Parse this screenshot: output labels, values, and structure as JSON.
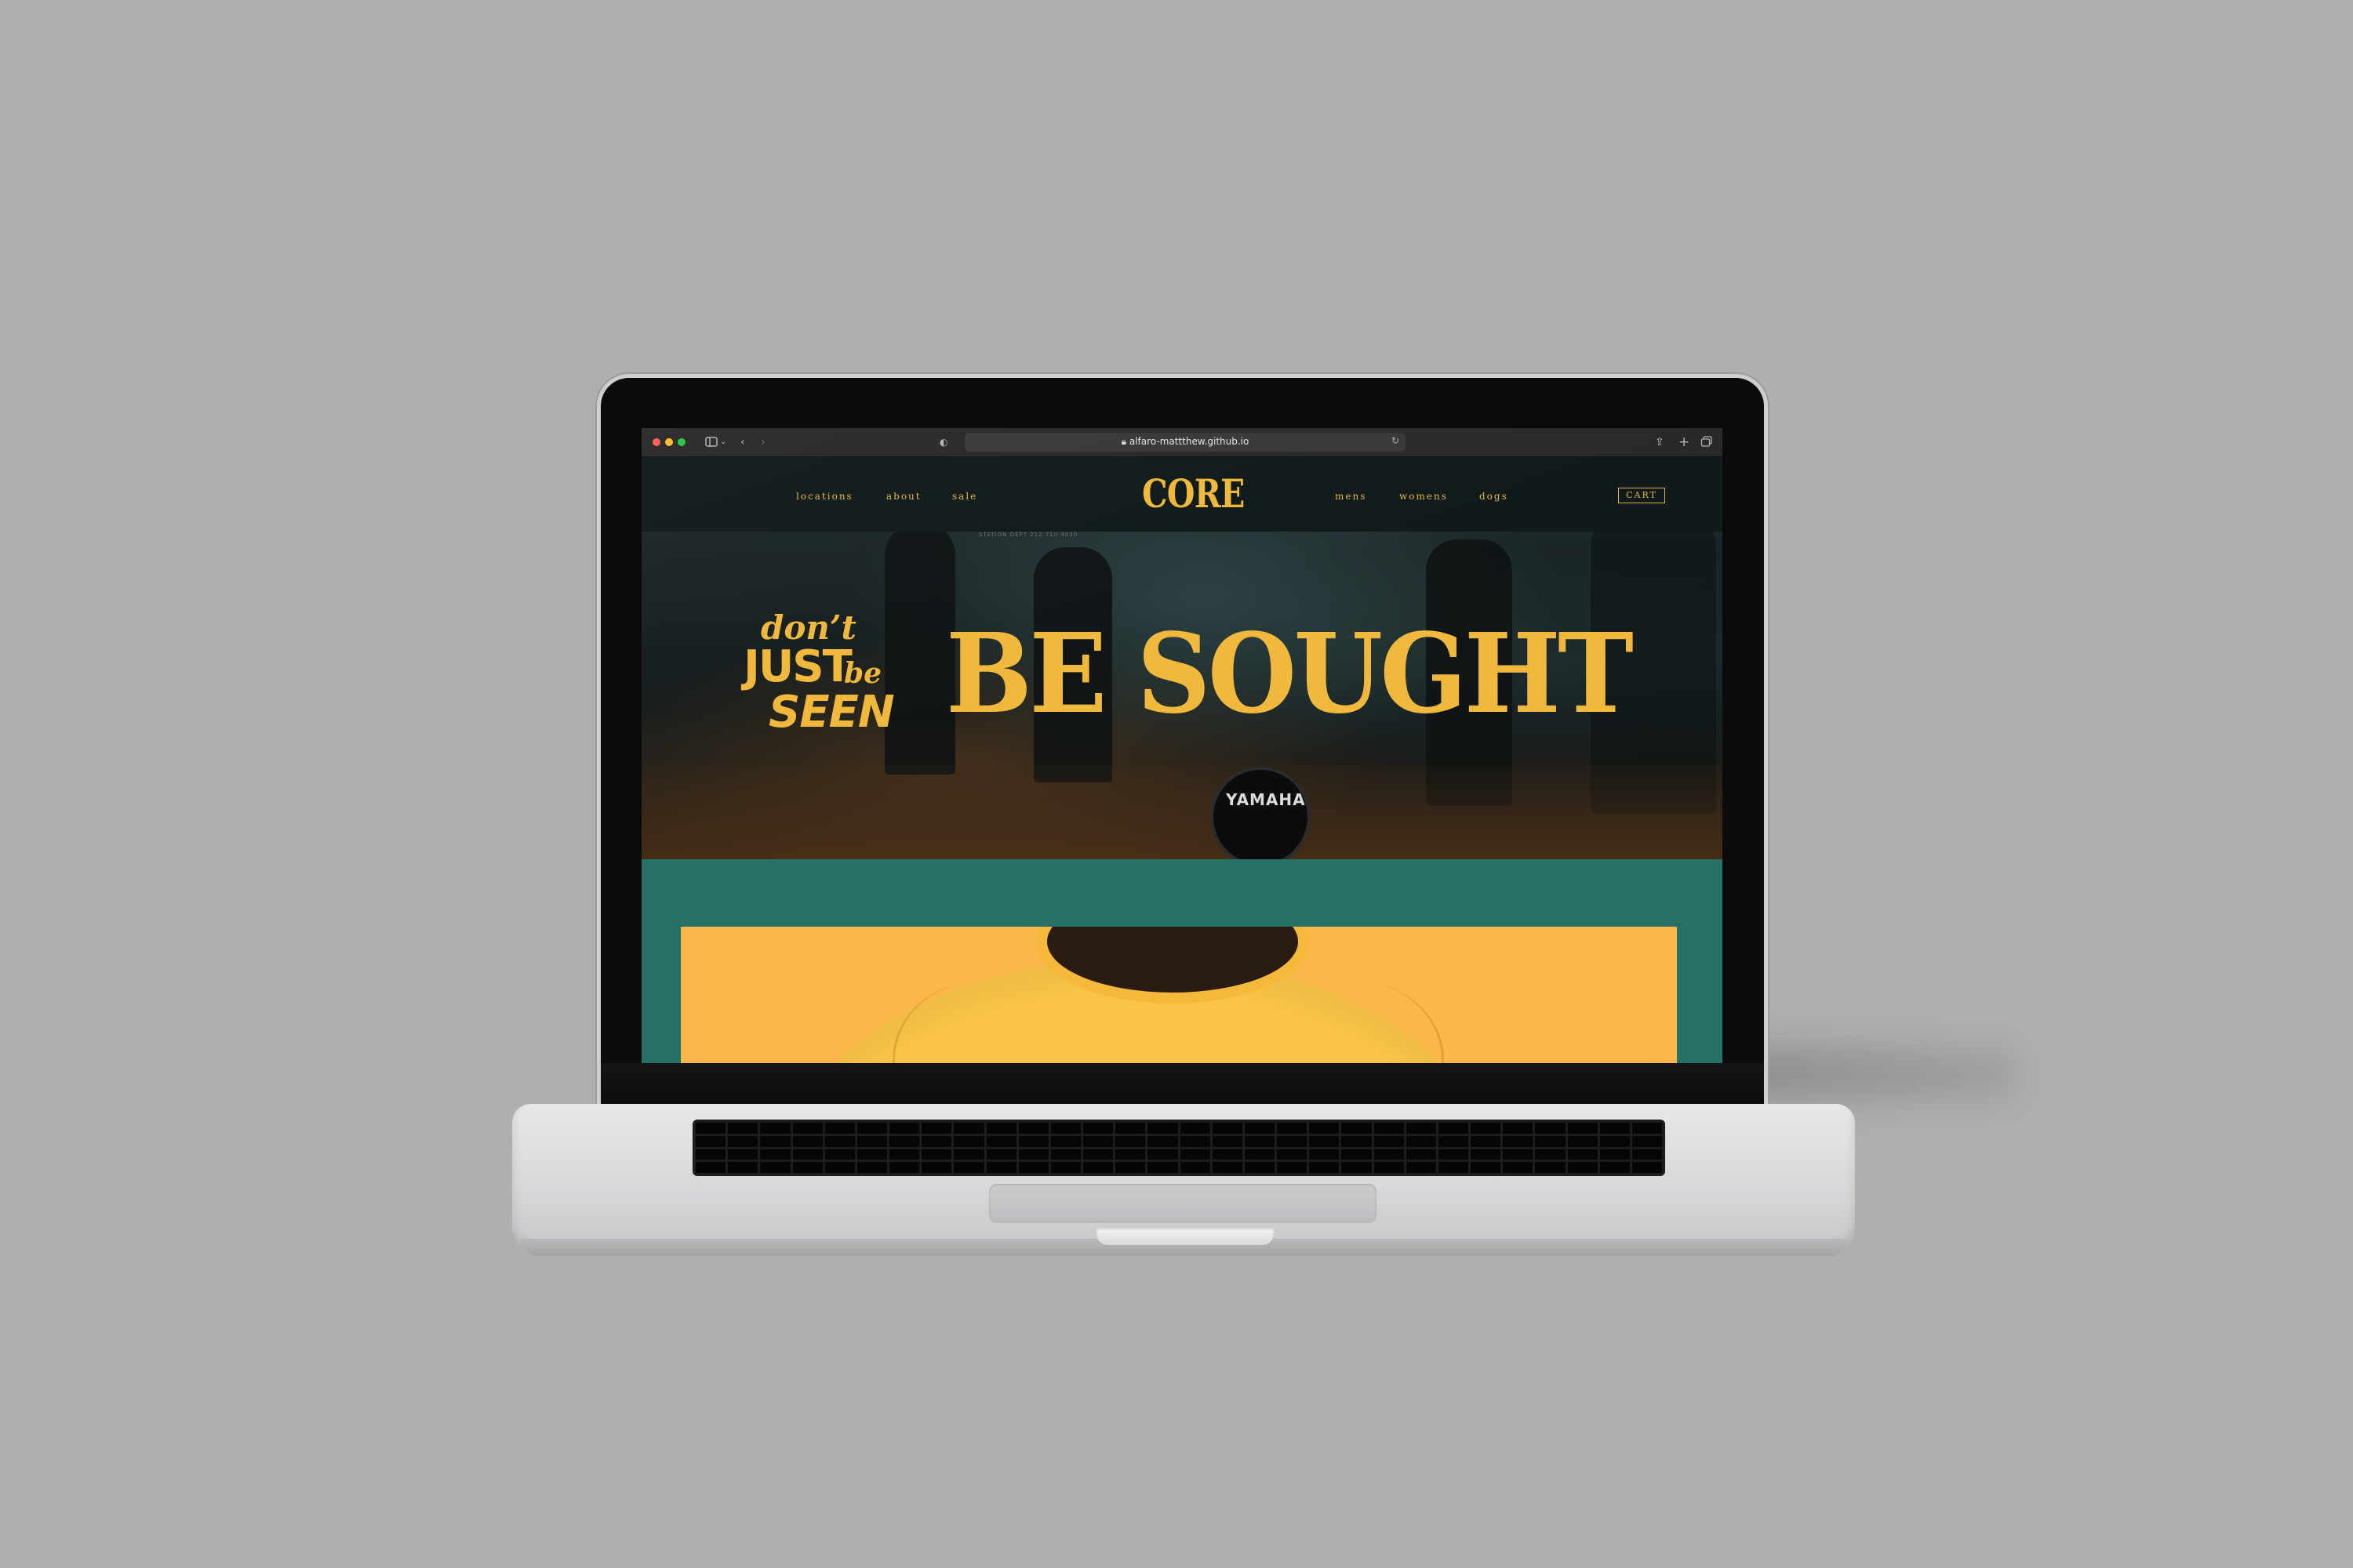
{
  "browser": {
    "url": "alfaro-mattthew.github.io",
    "icons": [
      "sidebar-icon",
      "back-icon",
      "forward-icon",
      "privacy-icon",
      "lock-icon",
      "reload-icon",
      "share-icon",
      "new-tab-icon",
      "tabs-overview-icon"
    ]
  },
  "site": {
    "logo": "CORE",
    "nav_left": [
      "locations",
      "about",
      "sale"
    ],
    "nav_right": [
      "mens",
      "womens",
      "dogs"
    ],
    "cart_label": "CART",
    "header_note": "STATION DEPT 212 710 4030"
  },
  "hero": {
    "line1": "don’t",
    "line2": "JUST",
    "line3": "be",
    "line4": "SEEN",
    "headline": "BE SOUGHT",
    "drum_brand": "YAMAHA"
  },
  "colors": {
    "accent": "#f0b83c",
    "section_bg": "#277066",
    "product_bg": "#fbb747",
    "background": "#afafaf"
  }
}
